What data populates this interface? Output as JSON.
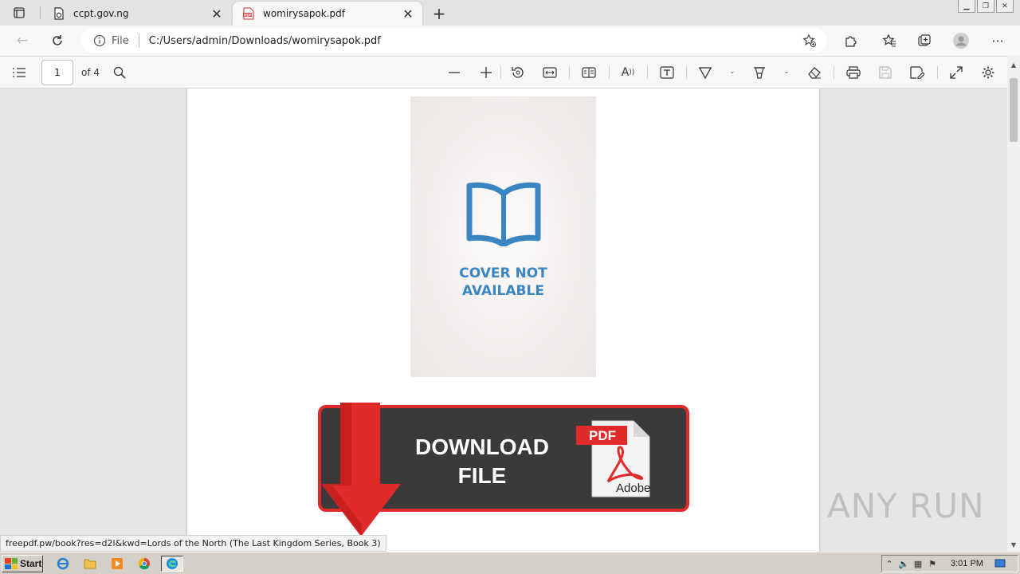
{
  "browser": {
    "tabs": [
      {
        "title": "ccpt.gov.ng",
        "active": false
      },
      {
        "title": "womirysapok.pdf",
        "active": true
      }
    ],
    "address": {
      "scheme_label": "File",
      "url": "C:/Users/admin/Downloads/womirysapok.pdf"
    },
    "pdf_favicon_text": "PDF"
  },
  "pdf_toolbar": {
    "page_current": "1",
    "page_total_label": "of 4"
  },
  "document": {
    "cover_text_line1": "COVER NOT",
    "cover_text_line2": "AVAILABLE",
    "download_line1": "DOWNLOAD",
    "download_line2": "FILE",
    "pdf_badge": "PDF",
    "adobe_label": "Adobe"
  },
  "status_bar": {
    "link": "freepdf.pw/book?res=d2l&kwd=Lords of the North (The Last Kingdom Series, Book 3)"
  },
  "watermark": {
    "text": "ANY RUN"
  },
  "taskbar": {
    "start_label": "Start",
    "clock": "3:01 PM"
  },
  "colors": {
    "cover_blue": "#3a86c3",
    "banner_red": "#e12a2a",
    "banner_dark": "#3a3a3a"
  }
}
